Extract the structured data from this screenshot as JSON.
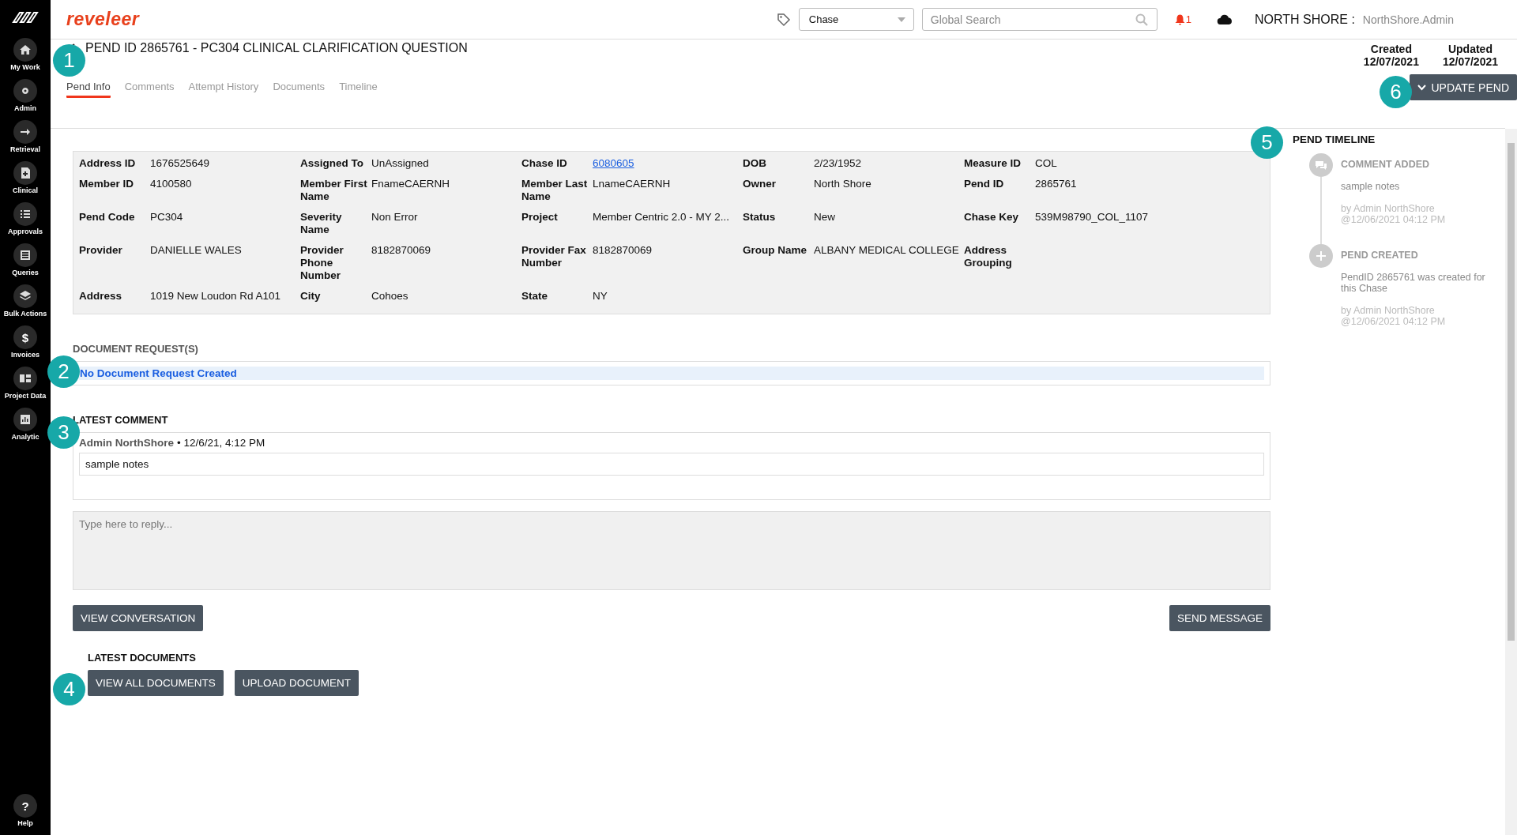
{
  "sidebar": {
    "items": [
      {
        "label": "My Work"
      },
      {
        "label": "Admin"
      },
      {
        "label": "Retrieval"
      },
      {
        "label": "Clinical"
      },
      {
        "label": "Approvals"
      },
      {
        "label": "Queries"
      },
      {
        "label": "Bulk Actions"
      },
      {
        "label": "Invoices",
        "glyph": "$"
      },
      {
        "label": "Project Data"
      },
      {
        "label": "Analytic"
      }
    ],
    "help": {
      "label": "Help",
      "glyph": "?"
    }
  },
  "header": {
    "logo": "reveleer",
    "select": "Chase",
    "search": {
      "placeholder": "Global Search"
    },
    "notifications": "1",
    "org": "NORTH SHORE :",
    "user": "NorthShore.Admin"
  },
  "page": {
    "title": "PEND ID 2865761 - PC304 CLINICAL CLARIFICATION QUESTION",
    "dates": [
      {
        "label": "Created",
        "value": "12/07/2021"
      },
      {
        "label": "Updated",
        "value": "12/07/2021"
      }
    ],
    "update_button": "UPDATE PEND"
  },
  "tabs": [
    {
      "label": "Pend Info",
      "selected": true
    },
    {
      "label": "Comments",
      "selected": false
    },
    {
      "label": "Attempt History",
      "selected": false
    },
    {
      "label": "Documents",
      "selected": false
    },
    {
      "label": "Timeline",
      "selected": false
    }
  ],
  "details": [
    {
      "label": "Address ID",
      "value": "1676525649"
    },
    {
      "label": "Assigned To",
      "value": "UnAssigned"
    },
    {
      "label": "Chase ID",
      "value": "6080605",
      "kind": "link"
    },
    {
      "label": "DOB",
      "value": "2/23/1952"
    },
    {
      "label": "Measure ID",
      "value": "COL"
    },
    {
      "label": "Member ID",
      "value": "4100580"
    },
    {
      "label": "Member First Name",
      "value": "FnameCAERNH"
    },
    {
      "label": "Member Last Name",
      "value": "LnameCAERNH"
    },
    {
      "label": "Owner",
      "value": "North Shore"
    },
    {
      "label": "Pend ID",
      "value": "2865761"
    },
    {
      "label": "Pend Code",
      "value": "PC304"
    },
    {
      "label": "Severity Name",
      "value": "Non Error"
    },
    {
      "label": "Project",
      "value": "Member Centric 2.0 - MY 2..."
    },
    {
      "label": "Status",
      "value": "New"
    },
    {
      "label": "Chase Key",
      "value": "539M98790_COL_1107"
    },
    {
      "label": "Provider",
      "value": "DANIELLE WALES"
    },
    {
      "label": "Provider Phone Number",
      "value": "8182870069"
    },
    {
      "label": "Provider Fax Number",
      "value": "8182870069"
    },
    {
      "label": "Group Name",
      "value": "ALBANY MEDICAL COLLEGE"
    },
    {
      "label": "Address Grouping"
    },
    {
      "label": "Address",
      "value": "1019 New Loudon Rd A101"
    },
    {
      "label": "City",
      "value": "Cohoes"
    },
    {
      "label": "State",
      "value": "NY"
    }
  ],
  "document_requests": {
    "heading": "DOCUMENT REQUEST(S)",
    "items": [
      "No Document Request Created"
    ]
  },
  "latest_comment": {
    "heading": "LATEST COMMENT",
    "author": "Admin NorthShore",
    "time": "• 12/6/21, 4:12 PM",
    "text": "sample notes"
  },
  "reply": {
    "placeholder": "Type here to reply..."
  },
  "comment_buttons": [
    "VIEW CONVERSATION",
    "SEND MESSAGE"
  ],
  "latest_documents": {
    "heading": "LATEST DOCUMENTS",
    "buttons": [
      "VIEW ALL DOCUMENTS",
      "UPLOAD DOCUMENT"
    ]
  },
  "timeline": {
    "heading": "PEND TIMELINE",
    "events": [
      {
        "kind": "comment",
        "title": "COMMENT ADDED",
        "body": "sample notes",
        "by": "by Admin NorthShore",
        "at": "@12/06/2021 04:12 PM"
      },
      {
        "kind": "created",
        "title": "PEND CREATED",
        "body": "PendID 2865761 was created for this Chase",
        "by": "by Admin NorthShore",
        "at": "@12/06/2021 04:12 PM"
      }
    ]
  },
  "callouts": [
    "1",
    "2",
    "3",
    "4",
    "5",
    "6"
  ]
}
